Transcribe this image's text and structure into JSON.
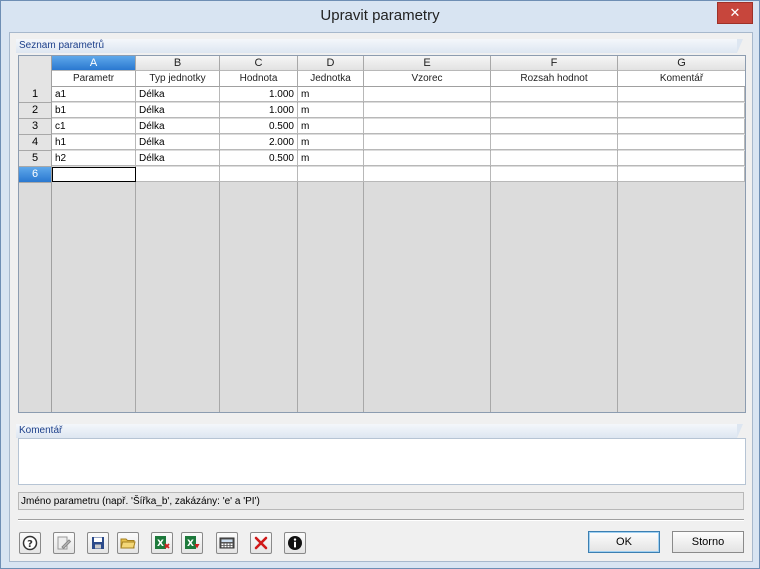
{
  "window": {
    "title": "Upravit parametry",
    "close_glyph": "✕"
  },
  "parameter_list": {
    "header": "Seznam parametrů",
    "columns": [
      {
        "letter": "A",
        "title": "Parametr"
      },
      {
        "letter": "B",
        "title": "Typ jednotky"
      },
      {
        "letter": "C",
        "title": "Hodnota"
      },
      {
        "letter": "D",
        "title": "Jednotka"
      },
      {
        "letter": "E",
        "title": "Vzorec"
      },
      {
        "letter": "F",
        "title": "Rozsah hodnot"
      },
      {
        "letter": "G",
        "title": "Komentář"
      }
    ],
    "rows": [
      {
        "num": "1",
        "param": "a1",
        "unit_type": "Délka",
        "value": "1.000",
        "unit": "m",
        "formula": "",
        "range": "",
        "comment": ""
      },
      {
        "num": "2",
        "param": "b1",
        "unit_type": "Délka",
        "value": "1.000",
        "unit": "m",
        "formula": "",
        "range": "",
        "comment": ""
      },
      {
        "num": "3",
        "param": "c1",
        "unit_type": "Délka",
        "value": "0.500",
        "unit": "m",
        "formula": "",
        "range": "",
        "comment": ""
      },
      {
        "num": "4",
        "param": "h1",
        "unit_type": "Délka",
        "value": "2.000",
        "unit": "m",
        "formula": "",
        "range": "",
        "comment": ""
      },
      {
        "num": "5",
        "param": "h2",
        "unit_type": "Délka",
        "value": "0.500",
        "unit": "m",
        "formula": "",
        "range": "",
        "comment": ""
      },
      {
        "num": "6",
        "param": "",
        "unit_type": "",
        "value": "",
        "unit": "",
        "formula": "",
        "range": "",
        "comment": ""
      }
    ],
    "active_column": "A",
    "active_row": "6"
  },
  "comment": {
    "header": "Komentář",
    "value": ""
  },
  "hint": "Jméno parametru (např. 'Šířka_b', zakázány: 'e' a 'PI')",
  "toolbar": {
    "icons": [
      "help-icon",
      "edit-icon",
      "save-icon",
      "open-folder-icon",
      "excel-import-icon",
      "excel-export-icon",
      "calculator-icon",
      "delete-icon",
      "info-icon"
    ]
  },
  "buttons": {
    "ok": "OK",
    "cancel": "Storno"
  },
  "colors": {
    "accent": "#2a78d0",
    "close": "#c7463c",
    "section_text": "#1c3f8a"
  }
}
